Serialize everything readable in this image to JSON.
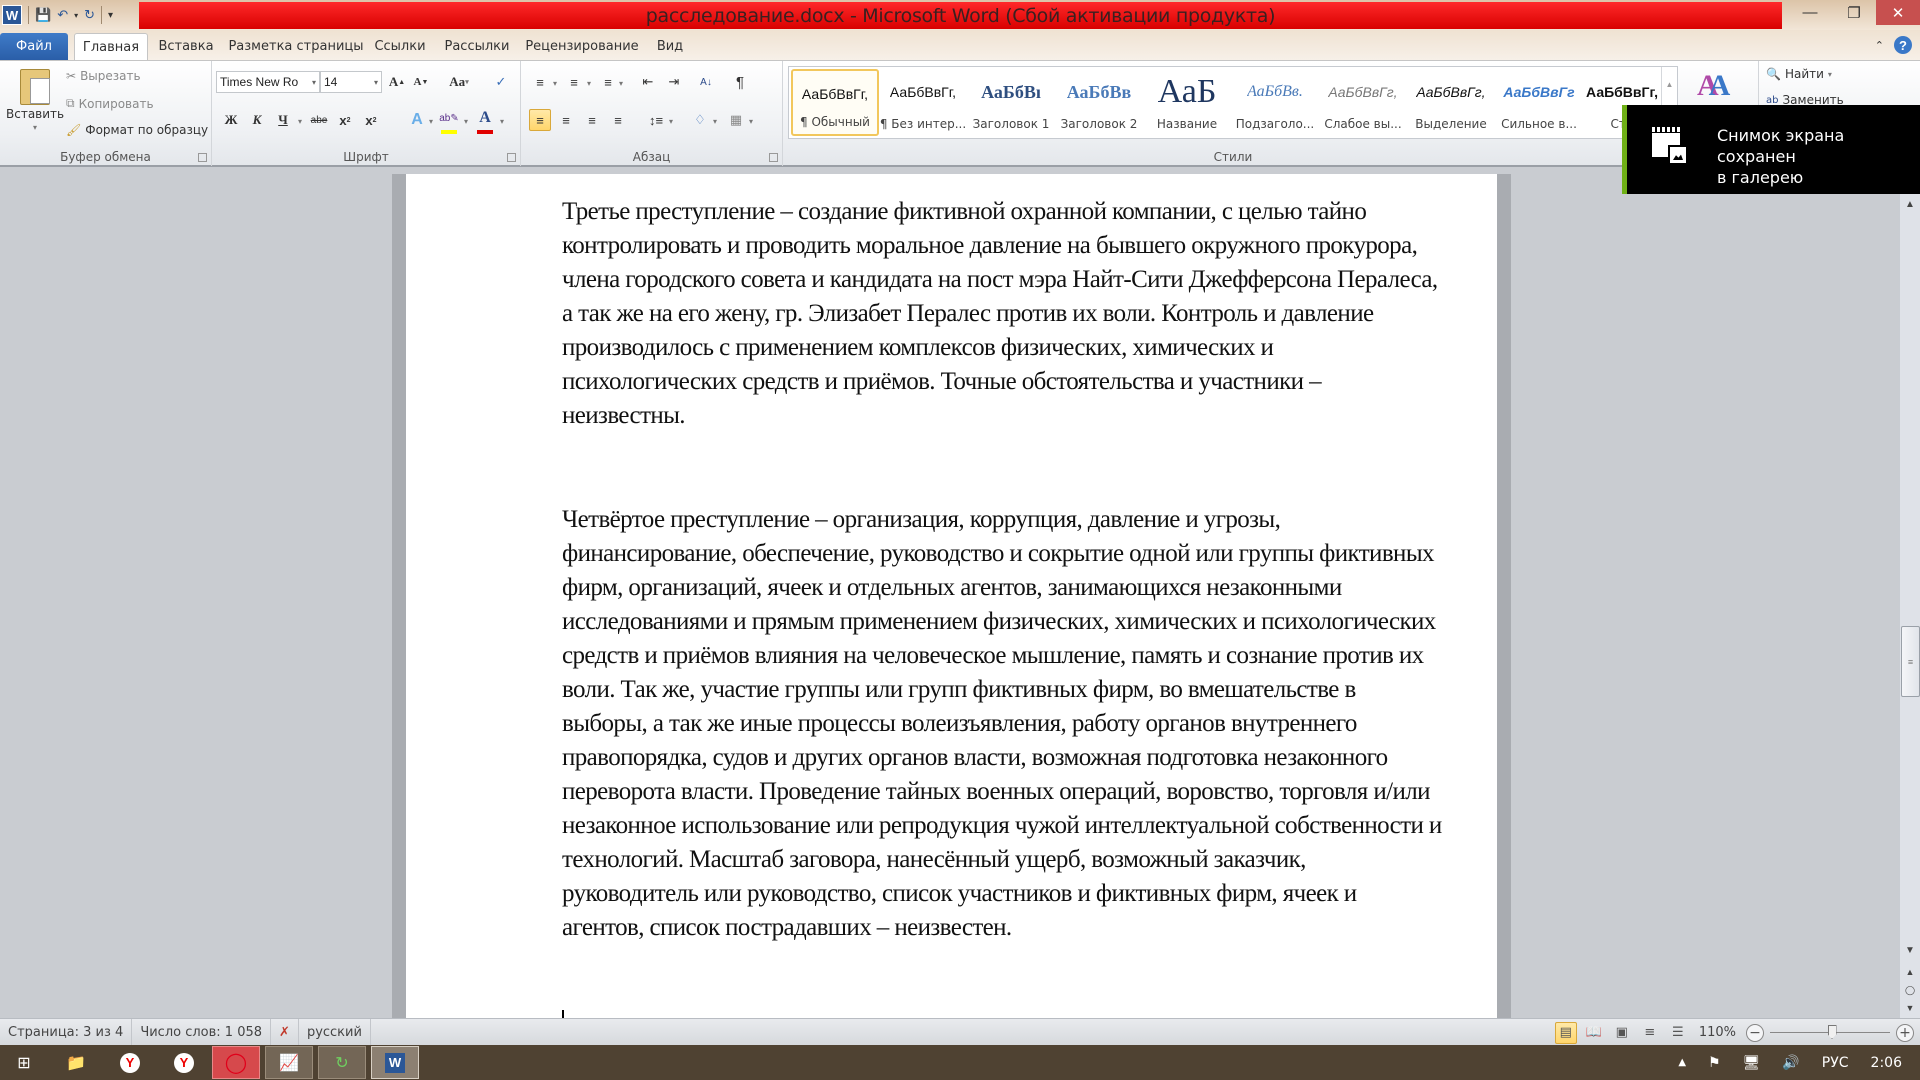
{
  "window": {
    "title": "расследование.docx - Microsoft Word (Сбой активации продукта)",
    "title_bar_color": "#e00000",
    "minimize_icon": "minimize-icon",
    "restore_icon": "restore-icon",
    "close_icon": "close-icon"
  },
  "quick_access": {
    "app_icon": "W",
    "items": [
      "save-icon",
      "undo-icon",
      "redo-icon",
      "customize-qat-icon"
    ]
  },
  "tabs": [
    {
      "label": "Файл",
      "active": false
    },
    {
      "label": "Главная",
      "active": true
    },
    {
      "label": "Вставка",
      "active": false
    },
    {
      "label": "Разметка страницы",
      "active": false
    },
    {
      "label": "Ссылки",
      "active": false
    },
    {
      "label": "Рассылки",
      "active": false
    },
    {
      "label": "Рецензирование",
      "active": false
    },
    {
      "label": "Вид",
      "active": false
    }
  ],
  "ribbon": {
    "clipboard": {
      "label": "Буфер обмена",
      "paste": "Вставить",
      "cut": "Вырезать",
      "copy": "Копировать",
      "format_painter": "Формат по образцу"
    },
    "font": {
      "label": "Шрифт",
      "font_name": "Times New Ro",
      "font_size": "14",
      "bold": "Ж",
      "italic": "К",
      "underline": "Ч",
      "strikethrough": "abe",
      "highlight_color": "#ffff00",
      "font_color": "#e00000"
    },
    "paragraph": {
      "label": "Абзац",
      "pilcrow": "¶",
      "active_alignment": "left"
    },
    "styles": {
      "label": "Стили",
      "items": [
        {
          "preview": "АаБбВвГг,",
          "name": "¶ Обычный",
          "selected": true
        },
        {
          "preview": "АаБбВвГг,",
          "name": "¶ Без интер...",
          "selected": false
        },
        {
          "preview": "АаБбВı",
          "name": "Заголовок 1",
          "selected": false
        },
        {
          "preview": "АаБбВв",
          "name": "Заголовок 2",
          "selected": false
        },
        {
          "preview": "АаБ",
          "name": "Название",
          "selected": false
        },
        {
          "preview": "АаБбВв.",
          "name": "Подзаголо...",
          "selected": false
        },
        {
          "preview": "АаБбВвГг,",
          "name": "Слабое вы...",
          "selected": false
        },
        {
          "preview": "АаБбВвГг,",
          "name": "Выделение",
          "selected": false
        },
        {
          "preview": "АаБбВвГг",
          "name": "Сильное в...",
          "selected": false
        },
        {
          "preview": "АаБбВвГг,",
          "name": "Стр",
          "selected": false
        }
      ]
    },
    "editing": {
      "find": "Найти",
      "replace": "Заменить"
    }
  },
  "document": {
    "paragraphs": [
      "Третье преступление – создание фиктивной охранной компании, с целью тайно контролировать и проводить моральное давление на бывшего окружного прокурора, члена городского совета и кандидата на пост мэра Найт-Сити Джефферсона Пералеса, а так же на его жену, гр. Элизабет Пералес против их воли. Контроль и давление производилось с применением комплексов физических, химических и психологических средств и приёмов. Точные обстоятельства и участники – неизвестны.",
      "Четвёртое преступление – организация, коррупция, давление и угрозы, финансирование, обеспечение, руководство и сокрытие одной или группы фиктивных фирм, организаций, ячеек и отдельных агентов, занимающихся незаконными исследованиями и прямым применением физических, химических и психологических средств и приёмов влияния на человеческое мышление, память и сознание против их воли. Так же, участие группы или групп фиктивных фирм, во вмешательстве в выборы, а так же иные процессы волеизъявления, работу органов внутреннего правопорядка, судов и других органов власти, возможная подготовка незаконного переворота власти. Проведение тайных военных операций, воровство, торговля и/или незаконное использование или репродукция чужой интеллектуальной собственности и технологий. Масштаб заговора, нанесённый ущерб, возможный заказчик, руководитель или руководство, список участников и фиктивных фирм, ячеек и агентов, список пострадавших – неизвестен."
    ]
  },
  "notification": {
    "text_line1": "Снимок экрана сохранен",
    "text_line2": "в галерею",
    "accent_color": "#6fb016",
    "icon": "screenshot-saved-icon"
  },
  "status_bar": {
    "page": "Страница: 3 из 4",
    "word_count": "Число слов: 1 058",
    "language": "русский",
    "zoom": "110%",
    "zoom_percent": 110
  },
  "taskbar": {
    "items": [
      "start-icon",
      "file-explorer-icon",
      "yandex-browser-icon",
      "yandex-browser-alt-icon",
      "opera-icon",
      "presentation-icon",
      "network-sync-icon",
      "word-icon"
    ],
    "tray": {
      "language": "РУС",
      "time": "2:06"
    }
  }
}
